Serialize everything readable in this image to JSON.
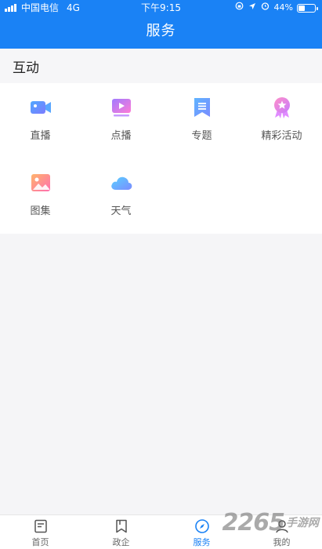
{
  "status_bar": {
    "carrier": "中国电信",
    "network": "4G",
    "time": "下午9:15",
    "battery": "44%",
    "battery_level": 0.44
  },
  "header": {
    "title": "服务"
  },
  "section": {
    "title": "互动",
    "items": [
      {
        "label": "直播",
        "icon": "live-video-icon"
      },
      {
        "label": "点播",
        "icon": "vod-play-icon"
      },
      {
        "label": "专题",
        "icon": "topic-bookmark-icon"
      },
      {
        "label": "精彩活动",
        "icon": "award-star-icon"
      },
      {
        "label": "图集",
        "icon": "gallery-image-icon"
      },
      {
        "label": "天气",
        "icon": "weather-cloud-icon"
      }
    ]
  },
  "tabbar": {
    "items": [
      {
        "label": "首页",
        "icon": "home-doc-icon"
      },
      {
        "label": "政企",
        "icon": "bookmark-icon"
      },
      {
        "label": "服务",
        "icon": "compass-icon"
      },
      {
        "label": "我的",
        "icon": "user-icon"
      }
    ],
    "active_index": 2
  },
  "watermark": {
    "number": "2265",
    "text": "手游网"
  },
  "colors": {
    "primary": "#1a82f5",
    "background": "#f5f5f7"
  }
}
